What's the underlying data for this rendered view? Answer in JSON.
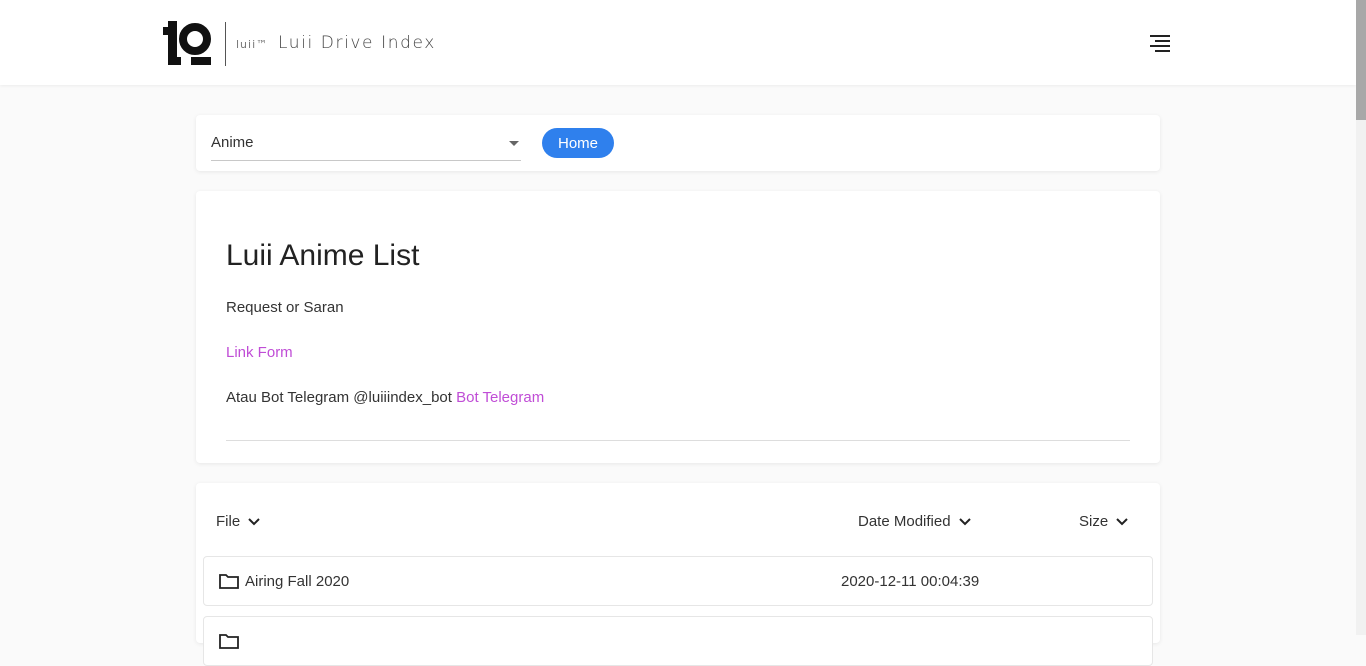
{
  "header": {
    "logo_small": "luii™",
    "site_title": "Luii Drive Index"
  },
  "nav": {
    "drive_selected": "Anime",
    "home_label": "Home"
  },
  "readme": {
    "title": "Luii Anime List",
    "line1": "Request or Saran",
    "link_form": "Link Form",
    "line3_prefix": "Atau Bot Telegram @luiiindex_bot",
    "link_bot": "Bot Telegram"
  },
  "file_list": {
    "columns": {
      "file": "File",
      "date": "Date Modified",
      "size": "Size"
    },
    "rows": [
      {
        "name": "Airing Fall 2020",
        "date": "2020-12-11 00:04:39",
        "size": ""
      },
      {
        "name": "",
        "date": "",
        "size": ""
      }
    ]
  },
  "colors": {
    "accent": "#2f80ed",
    "link": "#c04dd6"
  },
  "icons": [
    "luii-logo-icon",
    "menu-icon",
    "chevron-down-icon",
    "folder-icon"
  ]
}
